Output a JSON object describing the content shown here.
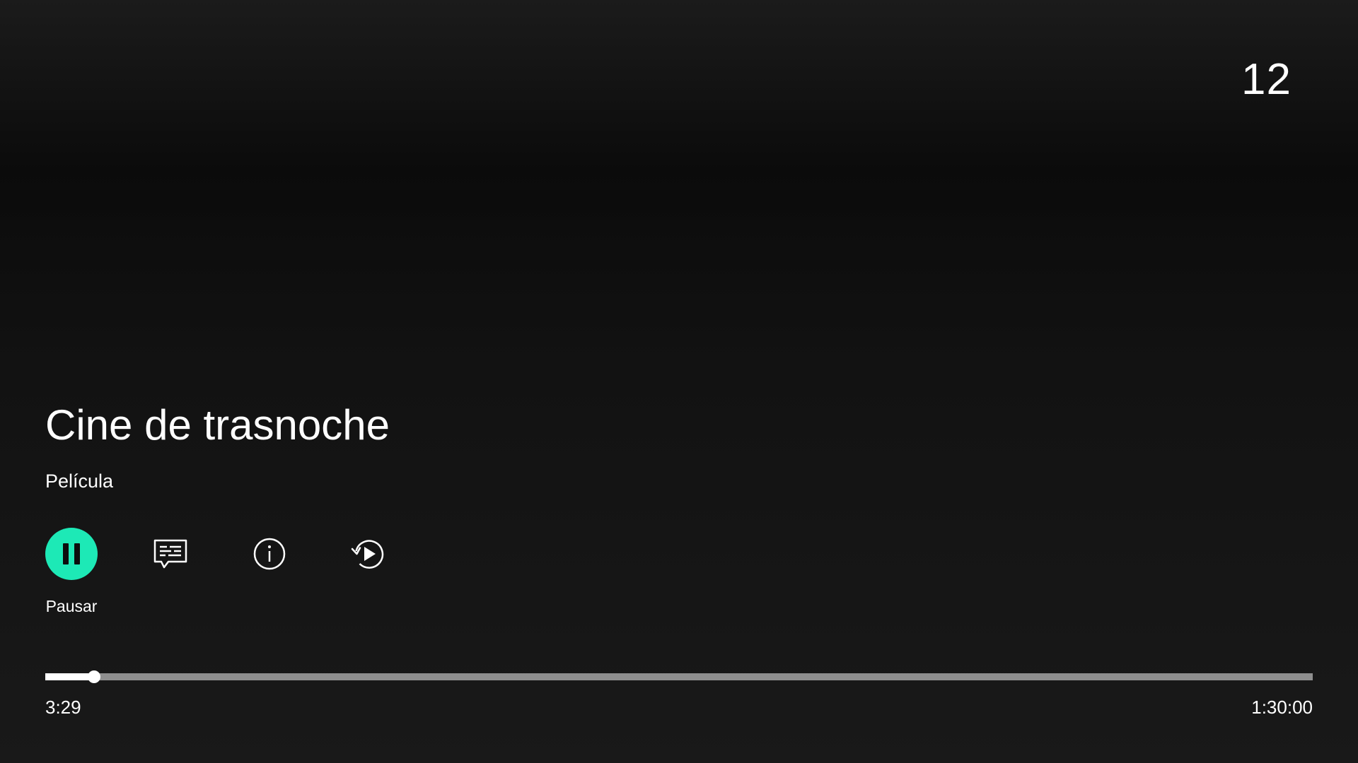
{
  "channel": {
    "number": "12"
  },
  "program": {
    "title": "Cine de trasnoche",
    "category": "Película"
  },
  "controls": {
    "play_pause": {
      "icon": "pause-icon",
      "label": "Pausar",
      "accent_color": "#1de9b6"
    },
    "subtitles": {
      "icon": "subtitles-icon"
    },
    "info": {
      "icon": "info-icon"
    },
    "restart": {
      "icon": "restart-icon"
    }
  },
  "playback": {
    "elapsed": "3:29",
    "duration": "1:30:00",
    "progress_fraction": 0.0387
  }
}
